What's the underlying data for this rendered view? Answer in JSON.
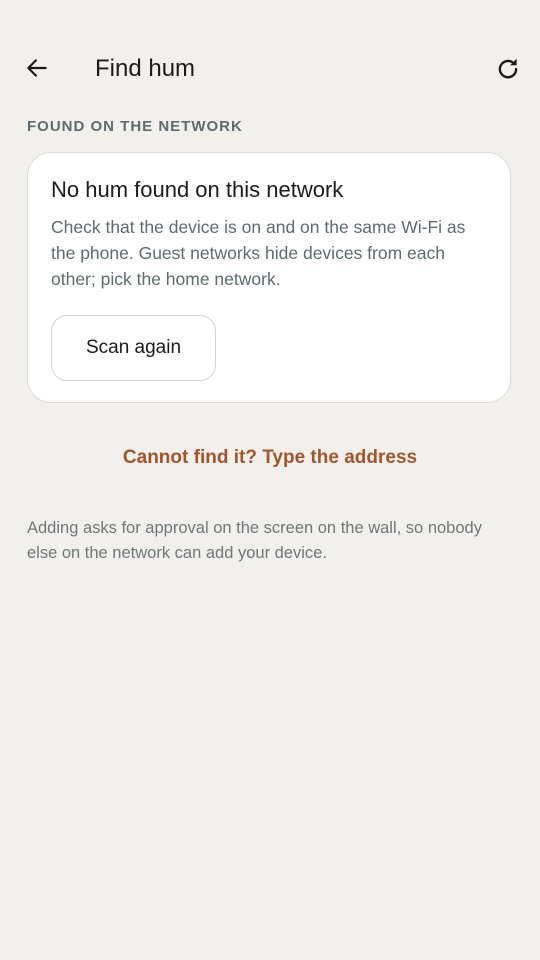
{
  "appbar": {
    "back_icon": "arrow-left-icon",
    "title": "Find hum",
    "refresh_icon": "refresh-icon"
  },
  "section": {
    "label": "FOUND ON THE NETWORK"
  },
  "empty_state": {
    "title": "No hum found on this network",
    "body": "Check that the device is on and on the same Wi-Fi as the phone. Guest networks hide devices from each other; pick the home network.",
    "scan_button": "Scan again"
  },
  "manual_link": "Cannot find it? Type the address",
  "footnote": "Adding asks for approval on the screen on the wall, so nobody else on the network can add your device.",
  "colors": {
    "background": "#f2f0ec",
    "card": "#ffffff",
    "accent_link": "#a4542a",
    "muted_text": "#5f6b6e"
  }
}
